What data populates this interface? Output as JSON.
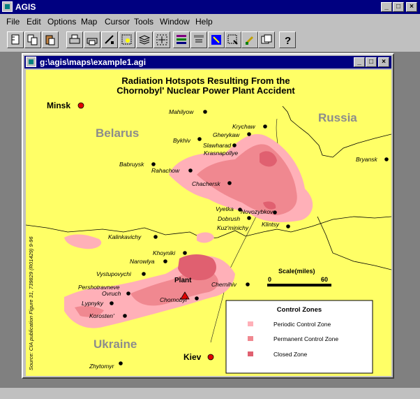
{
  "app": {
    "title": "AGIS"
  },
  "window_buttons": {
    "minimize": "_",
    "maximize": "□",
    "close": "×"
  },
  "menu": [
    "File",
    "Edit",
    "Options",
    "Map",
    "Cursor",
    "Tools",
    "Window",
    "Help"
  ],
  "toolbar_icons": [
    "new-map-icon",
    "copy-icon",
    "paste-icon",
    "print-icon",
    "print-setup-icon",
    "draw-line-icon",
    "zoom-window-icon",
    "layers-icon",
    "layers-alt-icon",
    "select-icon",
    "pointer-icon",
    "highlight-icon",
    "refresh-icon",
    "help-icon"
  ],
  "doc": {
    "title": "g:\\agis\\maps\\example1.agi"
  },
  "map": {
    "title_line1": "Radiation Hotspots Resulting From the",
    "title_line2": "Chornobyl' Nuclear Power Plant Accident",
    "countries": {
      "belarus": "Belarus",
      "russia": "Russia",
      "ukraine": "Ukraine"
    },
    "capitals": {
      "minsk": "Minsk",
      "kiev": "Kiev"
    },
    "plant": "Plant",
    "cities": {
      "mahilyow": "Mahilyow",
      "krychaw": "Krychaw",
      "gherykaw": "Gherykaw",
      "bykhiv": "Bykhiv",
      "slawharad": "Slawharad",
      "krasnapollye": "Krasnapollye",
      "bryansk": "Bryansk",
      "babruysk": "Babruysk",
      "rahachow": "Rahachow",
      "chachersk": "Chachersk",
      "vyetka": "Vyetka",
      "novozybkov": "Novozybkov",
      "dobrush": "Dobrush",
      "klintsy": "Klintsy",
      "kuzminichy": "Kuz'minichy",
      "kalinkavichy": "Kalinkavichy",
      "khoyniki": "Khoyniki",
      "narowlya": "Narowlya",
      "vystupovychi": "Vystupovychi",
      "pershotravneve": "Pershotravneve",
      "ovruch": "Ovruch",
      "lypnyky": "Lypnyky",
      "chornobyl": "Chornobyl",
      "chernihiv": "Chernihiv",
      "korosten": "Korosten'",
      "zhytomyr": "Zhytomyr"
    },
    "scale": {
      "label": "Scale(miles)",
      "min": "0",
      "max": "60"
    },
    "legend": {
      "title": "Control  Zones",
      "items": [
        {
          "label": "Periodic Control Zone",
          "color": "#ffb0b8"
        },
        {
          "label": "Permanent Control Zone",
          "color": "#f08890"
        },
        {
          "label": "Closed Zone",
          "color": "#e06070"
        }
      ]
    },
    "source": "Source: CIA publication Figure 31, 739829 (R01429) 9-96"
  },
  "colors": {
    "land": "#ffff66",
    "zone_periodic": "#ffb0b8",
    "zone_permanent": "#f08890",
    "zone_closed": "#e06070",
    "title_bar": "#000080"
  }
}
